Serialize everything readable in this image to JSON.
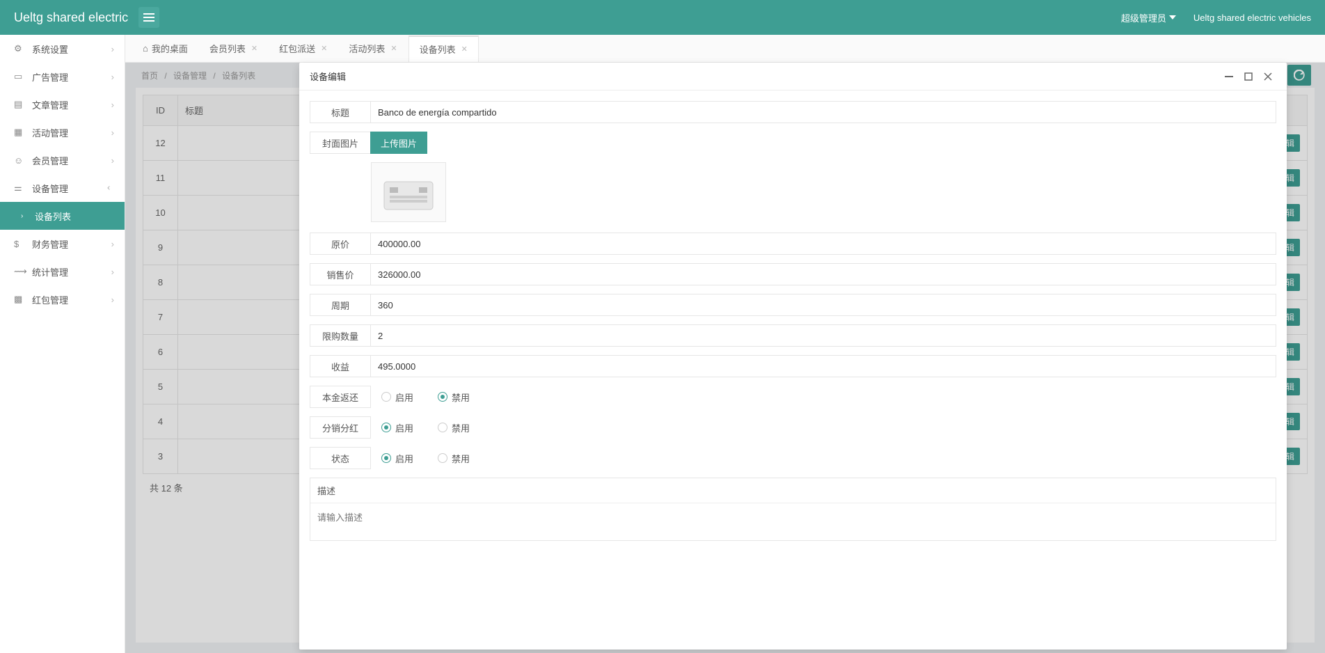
{
  "header": {
    "logo": "Ueltg shared electric",
    "user": "超级管理员",
    "sitename": "Ueltg shared electric vehicles"
  },
  "sidebar": {
    "items": [
      {
        "label": "系统设置"
      },
      {
        "label": "广告管理"
      },
      {
        "label": "文章管理"
      },
      {
        "label": "活动管理"
      },
      {
        "label": "会员管理"
      },
      {
        "label": "设备管理",
        "expanded": true
      },
      {
        "label": "财务管理"
      },
      {
        "label": "统计管理"
      },
      {
        "label": "红包管理"
      }
    ],
    "subitem": "设备列表"
  },
  "tabs": [
    {
      "label": "我的桌面",
      "home": true
    },
    {
      "label": "会员列表"
    },
    {
      "label": "红包派送"
    },
    {
      "label": "活动列表"
    },
    {
      "label": "设备列表",
      "active": true
    }
  ],
  "breadcrumb": [
    "首页",
    "设备管理",
    "设备列表"
  ],
  "table": {
    "headers": [
      "ID",
      "标题"
    ],
    "rows": [
      12,
      11,
      10,
      9,
      8,
      7,
      6,
      5,
      4,
      3
    ],
    "action": "辑",
    "footer": "共 12 条"
  },
  "modal": {
    "title": "设备编辑",
    "form": {
      "title_label": "标题",
      "title_value": "Banco de energía compartido",
      "cover_label": "封面图片",
      "upload_label": "上传图片",
      "price_label": "原价",
      "price_value": "400000.00",
      "sale_label": "销售价",
      "sale_value": "326000.00",
      "cycle_label": "周期",
      "cycle_value": "360",
      "limit_label": "限购数量",
      "limit_value": "2",
      "profit_label": "收益",
      "profit_value": "495.0000",
      "principal_label": "本金返还",
      "dividend_label": "分销分红",
      "status_label": "状态",
      "enable": "启用",
      "disable": "禁用",
      "desc_label": "描述",
      "desc_placeholder": "请输入描述"
    }
  }
}
